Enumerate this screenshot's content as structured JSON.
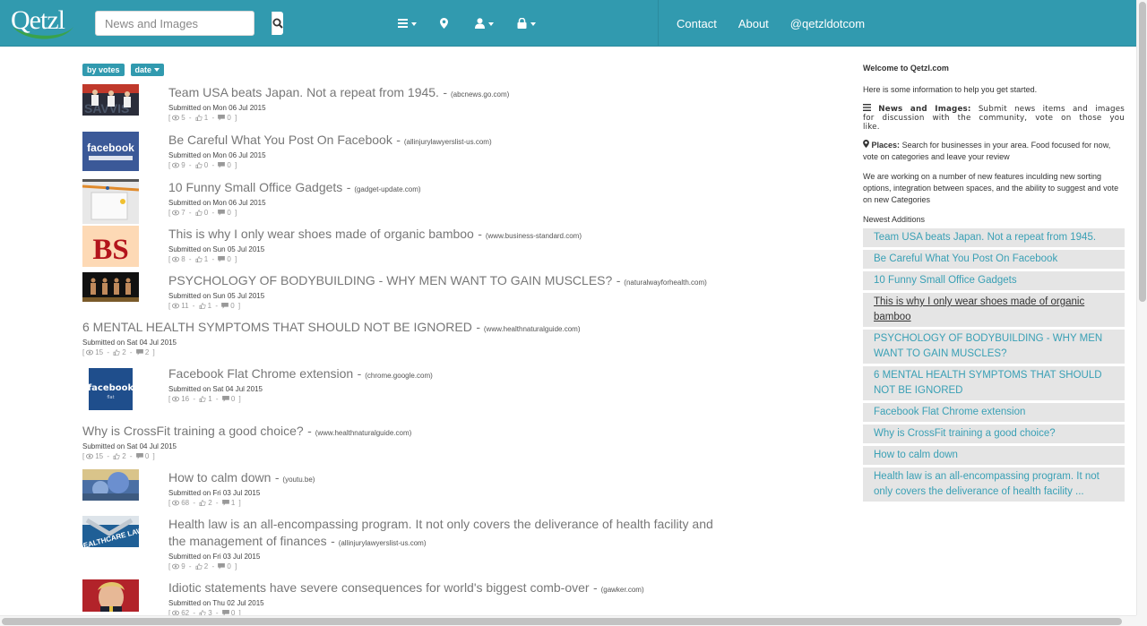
{
  "navbar": {
    "logo_text": "Qetzl",
    "search": {
      "placeholder": "News and Images",
      "value": ""
    },
    "icons": [
      {
        "name": "news-menu",
        "icon": "list-icon",
        "dropdown": true
      },
      {
        "name": "places",
        "icon": "map-marker-icon",
        "dropdown": false
      },
      {
        "name": "user-menu",
        "icon": "user-icon",
        "dropdown": true
      },
      {
        "name": "login-menu",
        "icon": "lock-icon",
        "dropdown": true
      }
    ],
    "links": [
      "Contact",
      "About",
      "@qetzldotcom"
    ]
  },
  "sort": {
    "by_votes": "by votes",
    "date": "date"
  },
  "accent_color": "#319aaf",
  "news": [
    {
      "title": "Team USA beats Japan. Not a repeat from 1945.",
      "source": "(abcnews.go.com)",
      "submitted": "Submitted on Mon 06 Jul 2015",
      "views": "5",
      "votes": "1",
      "comments": "0",
      "thumb": "soccer"
    },
    {
      "title": "Be Careful What You Post On Facebook",
      "source": "(allinjurylawyerslist-us.com)",
      "submitted": "Submitted on Mon 06 Jul 2015",
      "views": "9",
      "votes": "0",
      "comments": "0",
      "thumb": "facebook"
    },
    {
      "title": "10 Funny Small Office Gadgets",
      "source": "(gadget-update.com)",
      "submitted": "Submitted on Mon 06 Jul 2015",
      "views": "7",
      "votes": "0",
      "comments": "0",
      "thumb": "gadgets"
    },
    {
      "title": "This is why I only wear shoes made of organic bamboo",
      "source": "(www.business-standard.com)",
      "submitted": "Submitted on Sun 05 Jul 2015",
      "views": "8",
      "votes": "1",
      "comments": "0",
      "thumb": "bs"
    },
    {
      "title": "PSYCHOLOGY OF BODYBUILDING - WHY MEN WANT TO GAIN MUSCLES?",
      "source": "(naturalwayforhealth.com)",
      "submitted": "Submitted on Sun 05 Jul 2015",
      "views": "11",
      "votes": "1",
      "comments": "0",
      "thumb": "bodybuilding"
    },
    {
      "title": "6 MENTAL HEALTH SYMPTOMS THAT SHOULD NOT BE IGNORED",
      "source": "(www.healthnaturalguide.com)",
      "submitted": "Submitted on Sat 04 Jul 2015",
      "views": "15",
      "votes": "2",
      "comments": "2",
      "thumb": ""
    },
    {
      "title": "Facebook Flat Chrome extension",
      "source": "(chrome.google.com)",
      "submitted": "Submitted on Sat 04 Jul 2015",
      "views": "16",
      "votes": "1",
      "comments": "0",
      "thumb": "facebook-flat"
    },
    {
      "title": "Why is CrossFit training a good choice?",
      "source": "(www.healthnaturalguide.com)",
      "submitted": "Submitted on Sat 04 Jul 2015",
      "views": "15",
      "votes": "2",
      "comments": "0",
      "thumb": ""
    },
    {
      "title": "How to calm down",
      "source": "(youtu.be)",
      "submitted": "Submitted on Fri 03 Jul 2015",
      "views": "68",
      "votes": "2",
      "comments": "1",
      "thumb": "calm"
    },
    {
      "title": "Health law is an all-encompassing program. It not only covers the deliverance of health facility and the management of finances",
      "source": "(allinjurylawyerslist-us.com)",
      "submitted": "Submitted on Fri 03 Jul 2015",
      "views": "9",
      "votes": "2",
      "comments": "0",
      "thumb": "healthlaw"
    },
    {
      "title": "Idiotic statements have severe consequences for world's biggest comb-over",
      "source": "(gawker.com)",
      "submitted": "Submitted on Thu 02 Jul 2015",
      "views": "62",
      "votes": "3",
      "comments": "0",
      "thumb": "trump"
    }
  ],
  "sidebar": {
    "welcome": "Welcome to Qetzl.com",
    "intro": "Here is some information to help you get started.",
    "news_label": "News and Images:",
    "news_text": "Submit news items and images for discussion with the community, vote on those you like.",
    "places_label": "Places:",
    "places_text": "Search for businesses in your area. Food focused for now, vote on categories and leave your review",
    "working": "We are working on a number of new features inculding new sorting options, integration between spaces, and the ability to suggest and vote on new Categories",
    "newest_heading": "Newest Additions",
    "newest": [
      "Team USA beats Japan. Not a repeat from 1945.",
      "Be Careful What You Post On Facebook",
      "10 Funny Small Office Gadgets",
      "This is why I only wear shoes made of organic bamboo",
      "PSYCHOLOGY OF BODYBUILDING - WHY MEN WANT TO GAIN MUSCLES?",
      "6 MENTAL HEALTH SYMPTOMS THAT SHOULD NOT BE IGNORED",
      "Facebook Flat Chrome extension",
      "Why is CrossFit training a good choice?",
      "How to calm down",
      "Health law is an all-encompassing program. It not only covers the deliverance of health facility ..."
    ],
    "hovered_index": 3
  }
}
